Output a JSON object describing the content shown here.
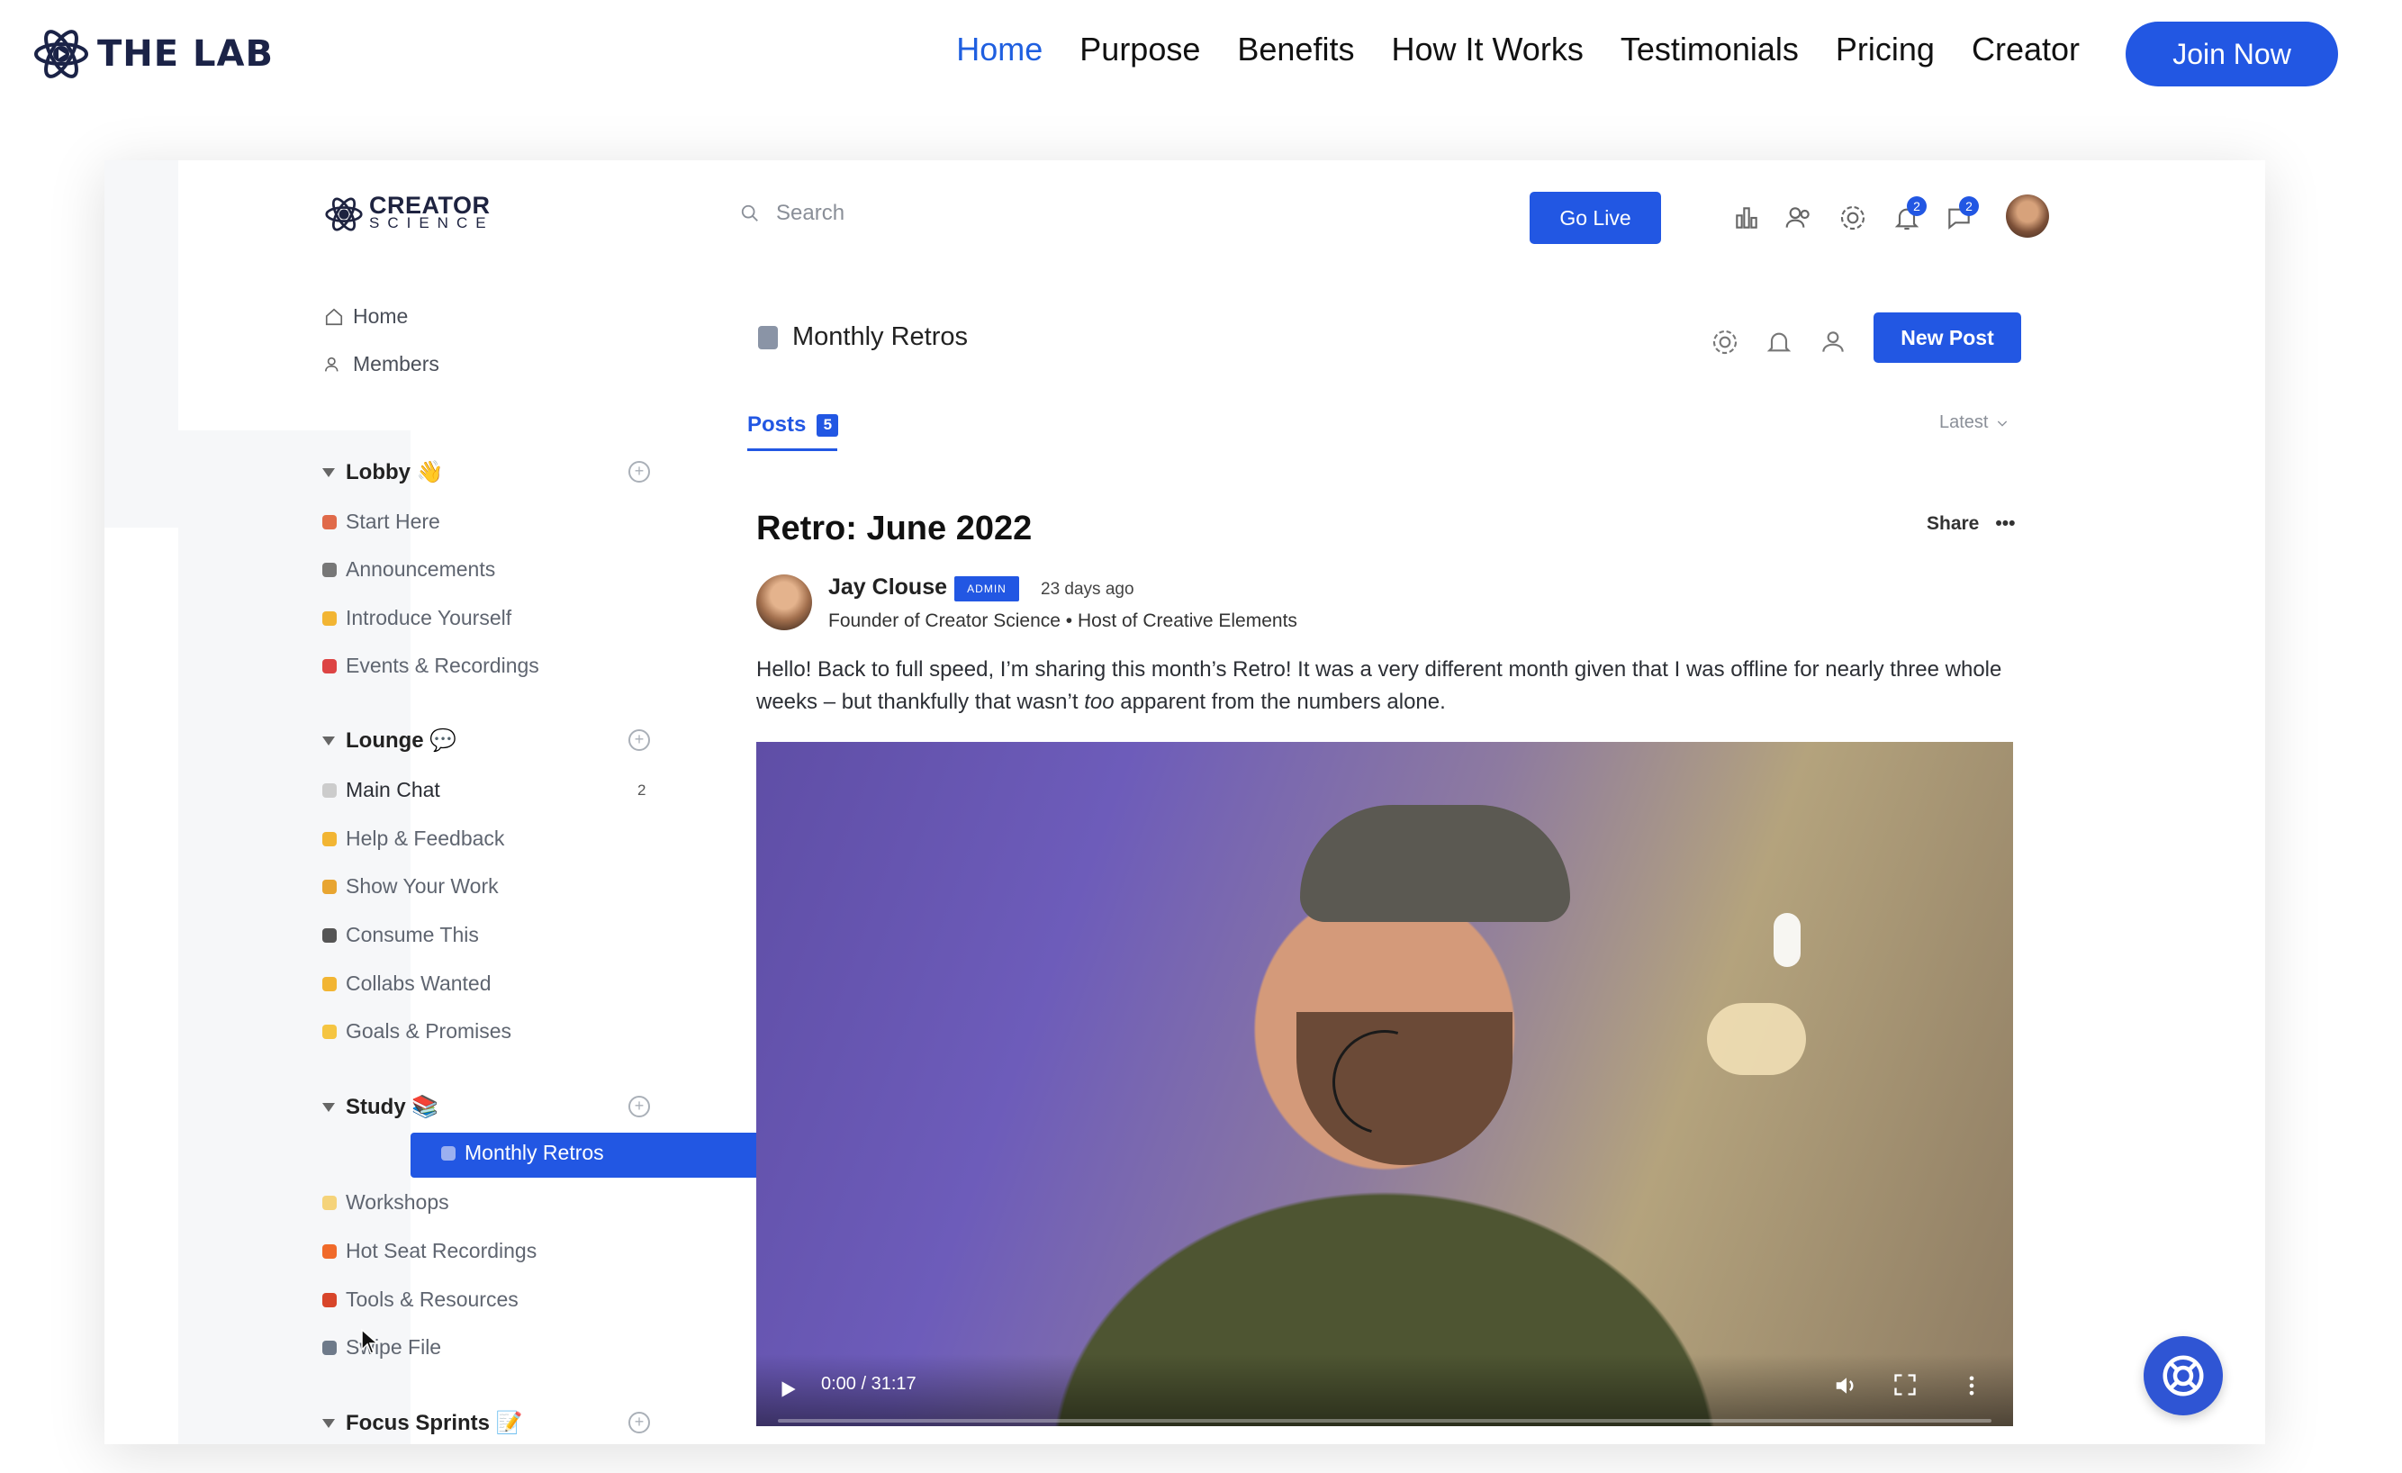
{
  "site": {
    "brand": "THE LAB",
    "nav": [
      "Home",
      "Purpose",
      "Benefits",
      "How It Works",
      "Testimonials",
      "Pricing",
      "Creator"
    ],
    "active_nav": "Home",
    "cta": "Join Now",
    "accent": "#2257e3"
  },
  "app": {
    "logo_line1": "CREATOR",
    "logo_line2": "SCIENCE",
    "search_placeholder": "Search",
    "go_live": "Go Live",
    "header_icons": [
      "analytics-icon",
      "members-icon",
      "settings-icon",
      "notifications-icon",
      "messages-icon"
    ],
    "notifications_count": "2",
    "messages_count": "2",
    "sidebar": {
      "top": [
        {
          "label": "Home",
          "icon": "home-icon"
        },
        {
          "label": "Members",
          "icon": "members-icon"
        }
      ],
      "groups": [
        {
          "title": "Lobby 👋",
          "items": [
            "Start Here",
            "Announcements",
            "Introduce Yourself",
            "Events & Recordings"
          ]
        },
        {
          "title": "Lounge 💬",
          "items": [
            "Main Chat",
            "Help & Feedback",
            "Show Your Work",
            "Consume This",
            "Collabs Wanted",
            "Goals & Promises"
          ]
        },
        {
          "title": "Study 📚",
          "items": [
            "Monthly Retros",
            "Workshops",
            "Hot Seat Recordings",
            "Tools & Resources",
            "Swipe File"
          ]
        },
        {
          "title": "Focus Sprints 📝",
          "items": []
        }
      ],
      "main_chat_count": "2",
      "active_item": "Monthly Retros"
    },
    "channel": {
      "title": "Monthly Retros",
      "new_post": "New Post",
      "tab": "Posts",
      "tab_count": "5",
      "sort": "Latest"
    },
    "post": {
      "title": "Retro: June 2022",
      "share": "Share",
      "author": "Jay Clouse",
      "badge": "ADMIN",
      "time": "23 days ago",
      "bio": "Founder of Creator Science • Host of Creative Elements",
      "body_part1": "Hello! Back to full speed, I’m sharing this month’s Retro! It was a very different month given that I was offline for nearly three whole weeks – but thankfully that wasn’t ",
      "body_emphasis": "too",
      "body_part2": " apparent from the numbers alone.",
      "video_time": "0:00 / 31:17",
      "video_progress": 0
    }
  }
}
